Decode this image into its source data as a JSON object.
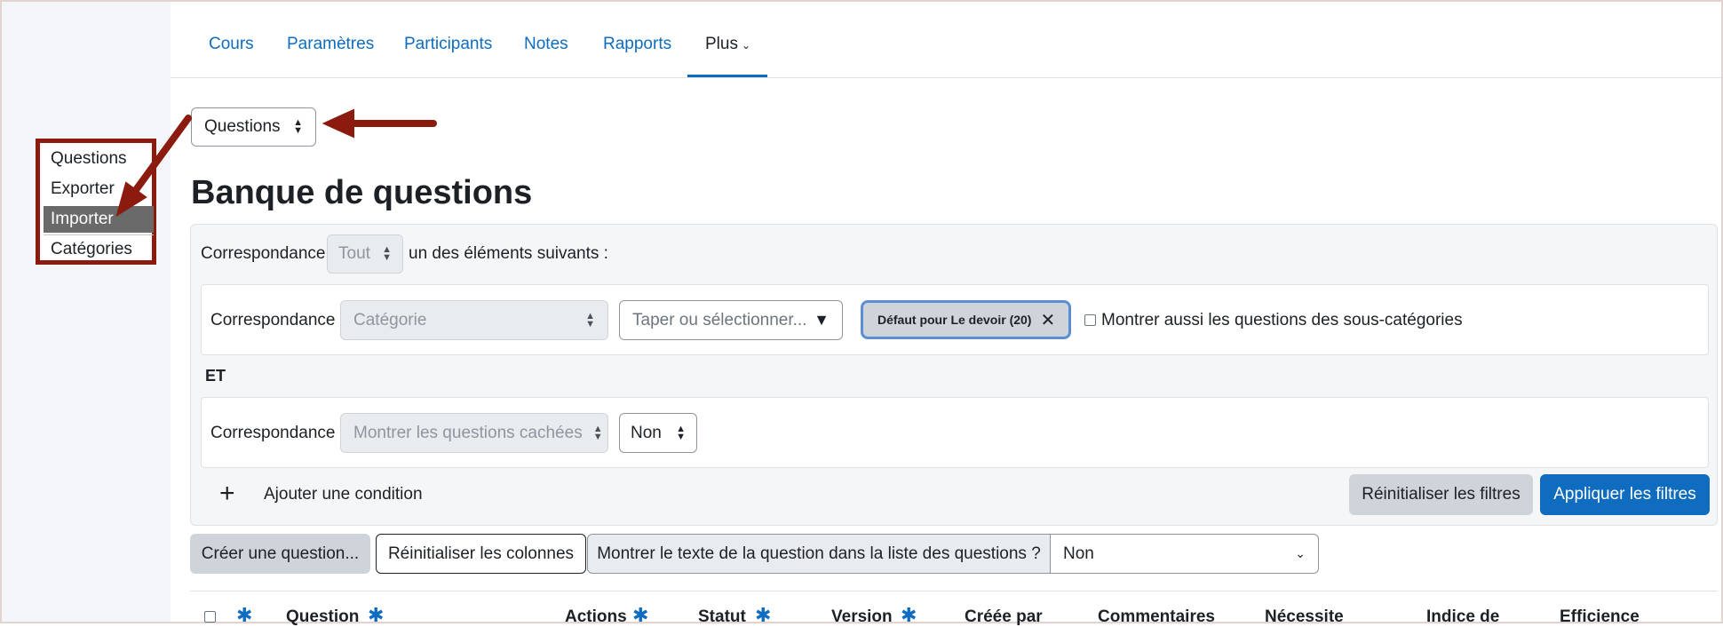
{
  "nav": {
    "tabs": [
      {
        "label": "Cours"
      },
      {
        "label": "Paramètres"
      },
      {
        "label": "Participants"
      },
      {
        "label": "Notes"
      },
      {
        "label": "Rapports"
      },
      {
        "label": "Plus"
      }
    ],
    "active_tab": "Plus"
  },
  "bank_select": {
    "value": "Questions"
  },
  "dropdown_menu": {
    "items": [
      "Questions",
      "Exporter",
      "Importer",
      "Catégories"
    ],
    "selected": "Importer"
  },
  "page_title": "Banque de questions",
  "filters": {
    "match_label": "Correspondance",
    "match_all_value": "Tout",
    "match_suffix": "un des éléments suivants :",
    "row1": {
      "label": "Correspondance",
      "type_value": "Catégorie",
      "search_placeholder": "Taper ou sélectionner...",
      "selected_pill": "Défaut pour Le devoir (20)",
      "subcat_checkbox_label": "Montrer aussi les questions des sous-catégories"
    },
    "and_label": "ET",
    "row2": {
      "label": "Correspondance",
      "type_value": "Montrer les questions cachées",
      "value": "Non"
    },
    "add_condition_label": "Ajouter une condition",
    "reset_button": "Réinitialiser les filtres",
    "apply_button": "Appliquer les filtres"
  },
  "toolbar": {
    "create_button": "Créer une question...",
    "reset_columns_button": "Réinitialiser les colonnes",
    "show_text_label": "Montrer le texte de la question dans la liste des questions ?",
    "show_text_value": "Non"
  },
  "table": {
    "columns": [
      "Question",
      "Actions",
      "Statut",
      "Version",
      "Créée par",
      "Commentaires",
      "Nécessite",
      "Indice de",
      "Efficience"
    ]
  },
  "colors": {
    "link": "#0f6cbf",
    "annotation": "#8b1a0f",
    "menu_selected_bg": "#6a6a6a"
  },
  "icons": [
    "chevron-down-icon",
    "up-down-arrows-icon",
    "close-icon",
    "plus-icon",
    "gear-icon",
    "caret-down-icon"
  ]
}
